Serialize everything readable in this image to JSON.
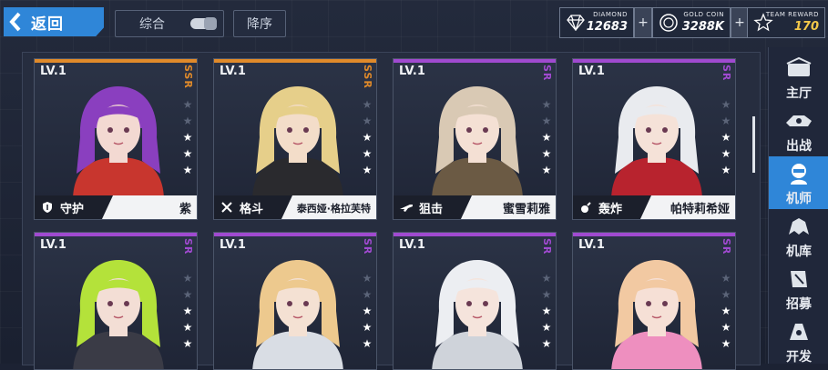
{
  "topbar": {
    "back_label": "返回",
    "sort_label": "综合",
    "order_label": "降序"
  },
  "resources": {
    "diamond": {
      "caption": "DIAMOND",
      "value": "12683",
      "icon": "diamond-icon"
    },
    "gold": {
      "caption": "GOLD COIN",
      "value": "3288K",
      "icon": "gold-coin-icon"
    },
    "team": {
      "caption": "TEAM REWARD",
      "value": "170",
      "icon": "star-medal-icon"
    },
    "plus": "+"
  },
  "cards": [
    {
      "level": "LV.1",
      "rarity": "SSR",
      "rarity_color": "#e08a2a",
      "stars": 5,
      "filled": 3,
      "class_icon": "shield-icon",
      "class": "守护",
      "name": "紫",
      "hair": "#8a3fbf",
      "skin": "#f3d9d2",
      "outfit": "#c8362e"
    },
    {
      "level": "LV.1",
      "rarity": "SSR",
      "rarity_color": "#e08a2a",
      "stars": 5,
      "filled": 3,
      "class_icon": "crossed-swords-icon",
      "class": "格斗",
      "name": "泰西娅·格拉芙特",
      "hair": "#e6cf8a",
      "skin": "#f3ddc9",
      "outfit": "#2a2a2e"
    },
    {
      "level": "LV.1",
      "rarity": "SR",
      "rarity_color": "#a04ad0",
      "stars": 5,
      "filled": 3,
      "class_icon": "rifle-icon",
      "class": "狙击",
      "name": "蜜雪莉雅",
      "hair": "#d9c9b4",
      "skin": "#f4e0d4",
      "outfit": "#6b5a44"
    },
    {
      "level": "LV.1",
      "rarity": "SR",
      "rarity_color": "#a04ad0",
      "stars": 5,
      "filled": 3,
      "class_icon": "bomb-icon",
      "class": "轰炸",
      "name": "帕特莉希娅",
      "hair": "#e9ebef",
      "skin": "#f5e2d8",
      "outfit": "#b8232e"
    },
    {
      "level": "LV.1",
      "rarity": "SR",
      "rarity_color": "#a04ad0",
      "stars": 5,
      "filled": 3,
      "hair": "#b4e23a",
      "skin": "#f3ded5",
      "outfit": "#3a3b46"
    },
    {
      "level": "LV.1",
      "rarity": "SR",
      "rarity_color": "#a04ad0",
      "stars": 5,
      "filled": 3,
      "hair": "#edc98e",
      "skin": "#f4e1d3",
      "outfit": "#d9dde4"
    },
    {
      "level": "LV.1",
      "rarity": "SR",
      "rarity_color": "#a04ad0",
      "stars": 5,
      "filled": 3,
      "hair": "#eceef2",
      "skin": "#f5e4dc",
      "outfit": "#cfd3da"
    },
    {
      "level": "LV.1",
      "rarity": "SR",
      "rarity_color": "#a04ad0",
      "stars": 5,
      "filled": 3,
      "hair": "#f2c9a2",
      "skin": "#f6e0d6",
      "outfit": "#ee8fbf"
    }
  ],
  "side_menu": [
    {
      "label": "主厅",
      "icon": "hall-icon",
      "active": false
    },
    {
      "label": "出战",
      "icon": "mech-sortie-icon",
      "active": false
    },
    {
      "label": "机师",
      "icon": "pilot-icon",
      "active": true
    },
    {
      "label": "机库",
      "icon": "hangar-icon",
      "active": false
    },
    {
      "label": "招募",
      "icon": "recruit-icon",
      "active": false
    },
    {
      "label": "开发",
      "icon": "develop-icon",
      "active": false
    }
  ]
}
